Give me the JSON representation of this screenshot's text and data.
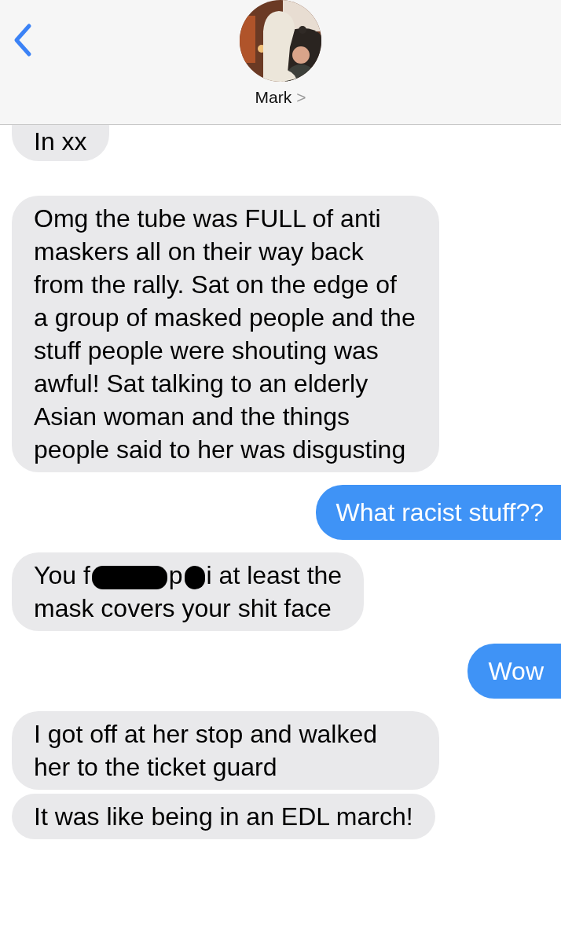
{
  "header": {
    "contact_name": "Mark",
    "chevron": ">"
  },
  "messages": [
    {
      "kind": "incoming",
      "segments": [
        {
          "kind": "text",
          "text": "In xx"
        }
      ]
    },
    {
      "kind": "incoming",
      "segments": [
        {
          "kind": "text",
          "text": "Omg the tube was FULL of anti maskers all on their way back from the rally. Sat on the edge of a group of masked people and the stuff people were shouting was awful! Sat talking to an elderly Asian woman and the things people said to her was disgusting"
        }
      ]
    },
    {
      "kind": "outgoing",
      "segments": [
        {
          "kind": "text",
          "text": "What racist stuff??"
        }
      ]
    },
    {
      "kind": "incoming",
      "segments": [
        {
          "kind": "text",
          "text": "You f"
        },
        {
          "kind": "redaction"
        },
        {
          "kind": "text",
          "text": "p"
        },
        {
          "kind": "redaction"
        },
        {
          "kind": "text",
          "text": "i at least the"
        },
        {
          "kind": "line_break"
        },
        {
          "kind": "text",
          "text": "mask covers your shit face"
        }
      ]
    },
    {
      "kind": "outgoing",
      "segments": [
        {
          "kind": "text",
          "text": "Wow"
        }
      ]
    },
    {
      "kind": "incoming",
      "segments": [
        {
          "kind": "text",
          "text": "I got off at her stop and walked her to the ticket guard"
        }
      ]
    },
    {
      "kind": "incoming",
      "segments": [
        {
          "kind": "text",
          "text": "It was like being in an EDL march!"
        }
      ]
    }
  ]
}
